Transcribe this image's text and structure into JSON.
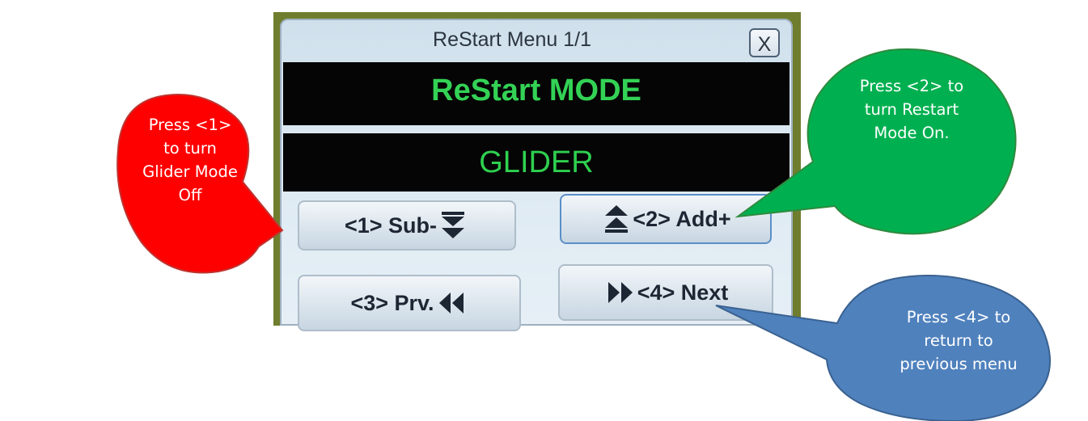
{
  "menu": {
    "title": "ReStart Menu 1/1",
    "close_label": "X",
    "mode_label": "ReStart MODE",
    "value_label": "GLIDER"
  },
  "buttons": {
    "b1": "<1> Sub-",
    "b2": "<2> Add+",
    "b3": "<3> Prv.",
    "b4": "<4> Next"
  },
  "callouts": {
    "red": [
      "Press <1>",
      "to turn",
      "Glider Mode",
      "Off"
    ],
    "green": [
      "Press <2> to",
      "turn Restart",
      "Mode On."
    ],
    "blue": [
      "Press <4> to",
      "return to",
      "previous menu"
    ]
  },
  "colors": {
    "red_callout": "#ff0000",
    "green_callout": "#00b050",
    "blue_callout": "#4f81bd",
    "lcd_text": "#33d255"
  }
}
